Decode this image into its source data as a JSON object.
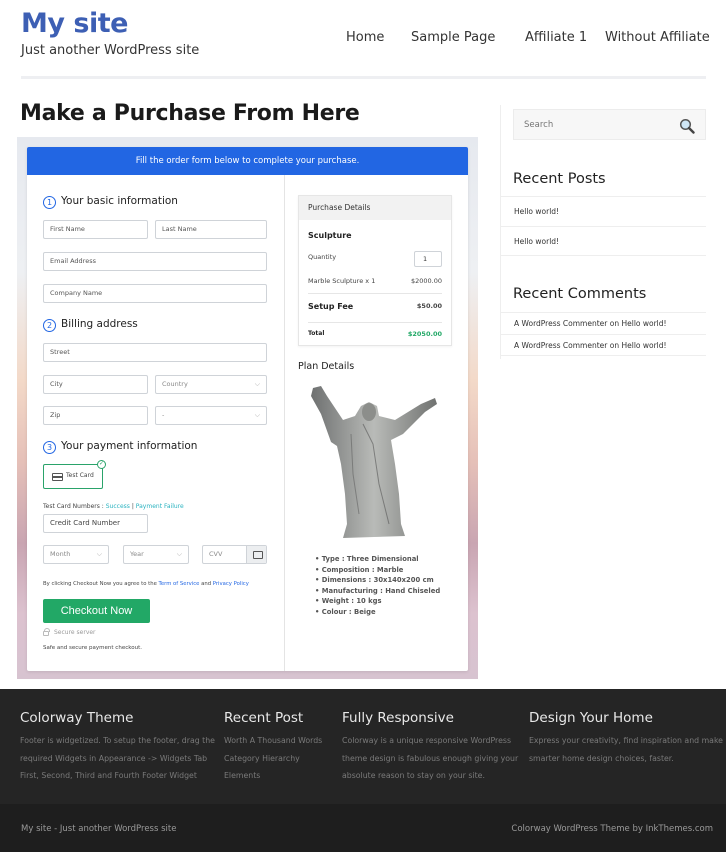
{
  "header": {
    "site_title": "My site",
    "site_description": "Just another WordPress site",
    "nav": [
      "Home",
      "Sample Page",
      "Affiliate 1",
      "Without Affiliate"
    ]
  },
  "main": {
    "page_title": "Make a Purchase From Here",
    "form": {
      "banner": "Fill the order form below to complete your purchase.",
      "step1": {
        "num": "1",
        "title": "Your basic information"
      },
      "step2": {
        "num": "2",
        "title": "Billing address"
      },
      "step3": {
        "num": "3",
        "title": "Your payment information"
      },
      "placeholders": {
        "first_name": "First Name",
        "last_name": "Last Name",
        "email": "Email Address",
        "company": "Company Name",
        "street": "Street",
        "city": "City",
        "country": "Country",
        "zip": "Zip",
        "state": "-",
        "card_number": "Credit Card Number",
        "month": "Month",
        "year": "Year",
        "cvv": "CVV"
      },
      "payment_method": "Test Card",
      "test_card_label": "Test Card Numbers :",
      "test_success": "Success",
      "test_separator": "|",
      "test_failure": "Payment Failure",
      "terms_prefix": "By clicking Checkout Now you agree to the",
      "terms_link": "Term of Service",
      "terms_and": "and",
      "privacy_link": "Privacy Policy",
      "checkout_button": "Checkout Now",
      "secure_server": "Secure server",
      "secure_note": "Safe and secure payment checkout."
    },
    "purchase": {
      "header": "Purchase Details",
      "product": "Sculpture",
      "quantity_label": "Quantity",
      "quantity_value": "1",
      "line_item": "Marble Sculpture x 1",
      "line_price": "$2000.00",
      "setup_label": "Setup Fee",
      "setup_price": "$50.00",
      "total_label": "Total",
      "total_price": "$2050.00",
      "total_color": "#22a866"
    },
    "plan": {
      "title": "Plan Details",
      "items": [
        "Type : Three Dimensional",
        "Composition : Marble",
        "Dimensions : 30x140x200 cm",
        "Manufacturing : Hand Chiseled",
        "Weight : 10 kgs",
        "Colour : Beige"
      ]
    }
  },
  "sidebar": {
    "search_placeholder": "Search",
    "recent_posts_title": "Recent Posts",
    "recent_posts": [
      "Hello world!",
      "Hello world!"
    ],
    "recent_comments_title": "Recent Comments",
    "recent_comments": [
      {
        "author": "A WordPress Commenter",
        "on": "on",
        "post": "Hello world!"
      },
      {
        "author": "A WordPress Commenter",
        "on": "on",
        "post": "Hello world!"
      }
    ]
  },
  "footer": {
    "columns": [
      {
        "title": "Colorway Theme",
        "lines": [
          "Footer is widgetized. To setup the footer, drag the",
          "required Widgets in Appearance -> Widgets Tab",
          "First, Second, Third and Fourth Footer Widget"
        ]
      },
      {
        "title": "Recent Post",
        "lines": [
          "Worth A Thousand Words",
          "Category Hierarchy",
          "Elements"
        ]
      },
      {
        "title": "Fully Responsive",
        "lines": [
          "Colorway is a unique responsive WordPress",
          "theme design is fabulous enough giving your",
          "absolute reason to stay on your site."
        ]
      },
      {
        "title": "Design Your Home",
        "lines": [
          "Express your creativity, find inspiration and make",
          "smarter home design choices, faster."
        ]
      }
    ],
    "copyright_left": "My site - Just another WordPress site",
    "copyright_right": "Colorway WordPress Theme by InkThemes.com"
  },
  "colors": {
    "brand_blue": "#3d5fb4",
    "form_blue": "#2266e3",
    "checkout_green": "#22a866"
  }
}
